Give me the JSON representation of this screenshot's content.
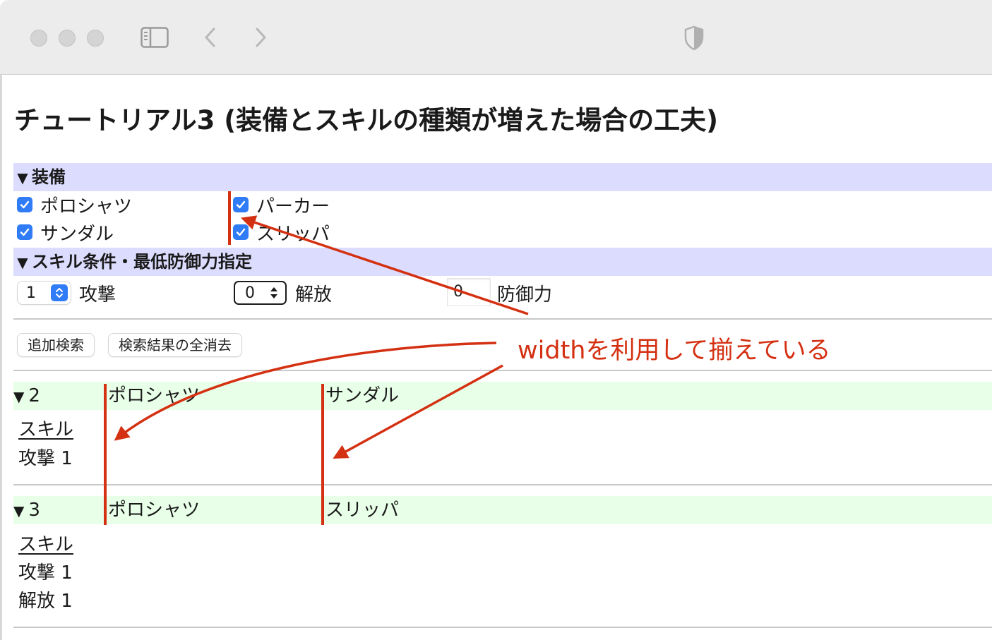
{
  "page": {
    "title": "チュートリアル3 (装備とスキルの種類が増えた場合の工夫)"
  },
  "equipment": {
    "header": "装備",
    "triangle": "▼",
    "items": [
      {
        "label": "ポロシャツ",
        "checked": true
      },
      {
        "label": "パーカー",
        "checked": true
      },
      {
        "label": "サンダル",
        "checked": true
      },
      {
        "label": "スリッパ",
        "checked": true
      }
    ]
  },
  "skill_conditions": {
    "header": "スキル条件・最低防御力指定",
    "triangle": "▼",
    "attack": {
      "value": "1",
      "label": "攻撃"
    },
    "release": {
      "value": "0",
      "label": "解放"
    },
    "defense": {
      "value": "0",
      "label": "防御力"
    }
  },
  "buttons": {
    "add_search": "追加検索",
    "clear_results": "検索結果の全消去"
  },
  "results": [
    {
      "triangle": "▼",
      "number": "2",
      "col1": "ポロシャツ",
      "col2": "サンダル",
      "skill_heading": "スキル",
      "skills": [
        "攻撃 1"
      ]
    },
    {
      "triangle": "▼",
      "number": "3",
      "col1": "ポロシャツ",
      "col2": "スリッパ",
      "skill_heading": "スキル",
      "skills": [
        "攻撃 1",
        "解放 1"
      ]
    }
  ],
  "annotation": {
    "text": "widthを利用して揃えている",
    "color": "#d43012"
  },
  "colors": {
    "equipment_header_bg": "#dcdcff",
    "result_header_bg": "#e8ffe8",
    "checkbox": "#2f7cf6",
    "annotation_red": "#d43012"
  }
}
